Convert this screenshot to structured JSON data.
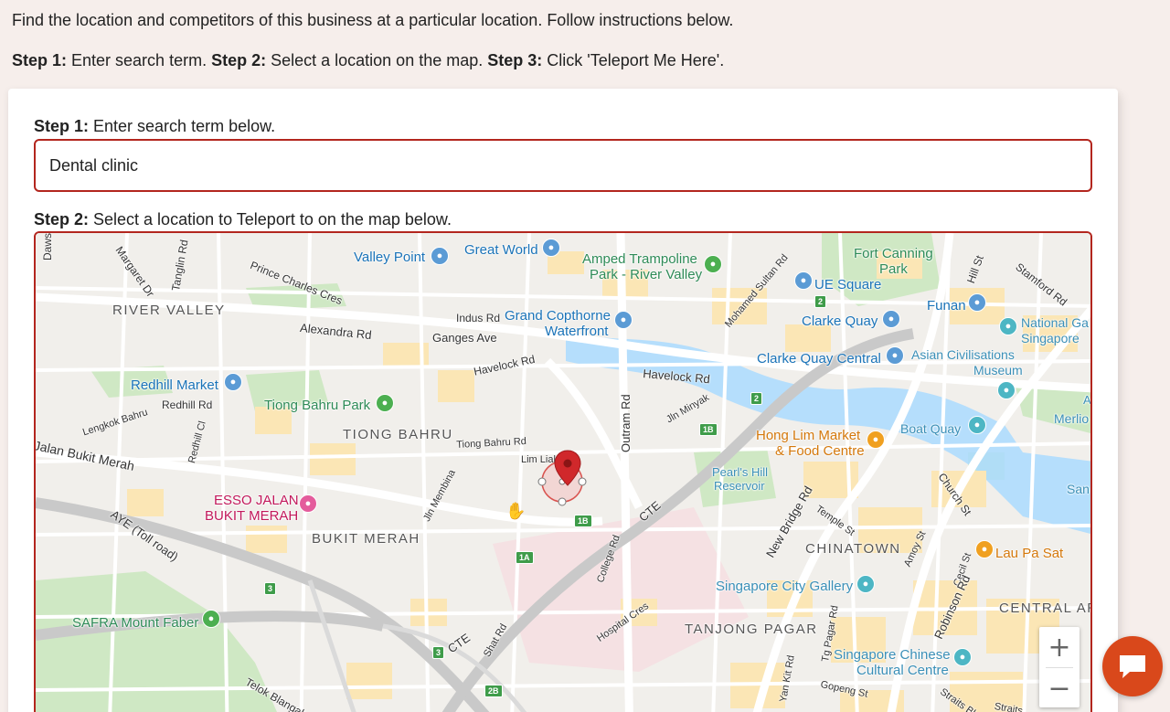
{
  "instructions": {
    "intro": "Find the location and competitors of this business at a particular location. Follow instructions below.",
    "step1_bold": "Step 1:",
    "step1_text": " Enter search term. ",
    "step2_bold": "Step 2:",
    "step2_text": " Select a location on the map. ",
    "step3_bold": "Step 3:",
    "step3_text": " Click 'Teleport Me Here'."
  },
  "form": {
    "step1_label_bold": "Step 1:",
    "step1_label_text": " Enter search term below.",
    "search_value": "Dental clinic",
    "step2_label_bold": "Step 2:",
    "step2_label_text": " Select a location to Teleport to on the map below."
  },
  "map": {
    "areas": {
      "river_valley": "RIVER VALLEY",
      "tiong_bahru": "TIONG BAHRU",
      "bukit_merah": "BUKIT MERAH",
      "chinatown": "CHINATOWN",
      "tanjong_pagar": "TANJONG PAGAR",
      "central_area": "CENTRAL AR"
    },
    "roads": {
      "dawson": "Dawso",
      "margaret_dr": "Margaret Dr",
      "tanglin_rd": "Tanglin Rd",
      "prince_charles": "Prince Charles Cres",
      "alexandra_rd": "Alexandra Rd",
      "indus_rd": "Indus Rd",
      "ganges_ave": "Ganges Ave",
      "havelock_rd_1": "Havelock Rd",
      "havelock_rd_2": "Havelock Rd",
      "redhill_rd": "Redhill Rd",
      "lengkok_bahru": "Lengkok Bahru",
      "redhill_cl": "Redhill Cl",
      "jalan_bukit_merah": "Jalan Bukit Merah",
      "tiong_bahru_rd": "Tiong Bahru Rd",
      "lim_liak": "Lim Liak",
      "jln_membina": "Jln Membina",
      "outram_rd": "Outram Rd",
      "jln_minyak": "Jln Minyak",
      "mohamed_sultan": "Mohamed Sultan Rd",
      "cte_1": "CTE",
      "cte_2": "CTE",
      "aye": "AYE (Toll road)",
      "college_rd": "College Rd",
      "hospital_cres": "Hospital Cres",
      "shat_rd": "Shat Rd",
      "telok_blangah": "Telok Blangah Way",
      "new_bridge": "New Bridge Rd",
      "temple_st": "Temple St",
      "amoy_st": "Amoy St",
      "cecil_st": "Cecil St",
      "robinson_rd": "Robinson Rd",
      "church_st": "Church St",
      "hill_st": "Hill St",
      "stamford_rd": "Stamford Rd",
      "tg_pagar_rd": "Tg Pagar Rd",
      "kan_kit_rd": "Yan Kit Rd",
      "gopeng_st": "Gopeng St",
      "straits_1": "Straits Bl",
      "straits_2": "Straits"
    },
    "pois": {
      "valley_point": "Valley Point",
      "great_world": "Great World",
      "amped_1": "Amped Trampoline",
      "amped_2": "Park - River Valley",
      "grand_copthorne_1": "Grand Copthorne",
      "grand_copthorne_2": "Waterfront",
      "fort_canning_1": "Fort Canning",
      "fort_canning_2": "Park",
      "ue_square": "UE Square",
      "clarke_quay": "Clarke Quay",
      "funan": "Funan",
      "national_gallery_1": "National Ga",
      "national_gallery_2": "Singapore",
      "clarke_quay_central": "Clarke Quay Central",
      "asian_civ_1": "Asian Civilisations",
      "asian_civ_2": "Museum",
      "redhill_market": "Redhill Market",
      "tiong_bahru_park": "Tiong Bahru Park",
      "hong_lim_1": "Hong Lim Market",
      "hong_lim_2": "& Food Centre",
      "boat_quay": "Boat Quay",
      "merlion": "Merlio",
      "pearls_hill_1": "Pearl's Hill",
      "pearls_hill_2": "Reservoir",
      "san": "San",
      "esso_1": "ESSO JALAN",
      "esso_2": "BUKIT MERAH",
      "lau_pa_sat": "Lau Pa Sat",
      "sg_city_gallery": "Singapore City Gallery",
      "safra": "SAFRA Mount Faber",
      "sg_chinese_1": "Singapore Chinese",
      "sg_chinese_2": "Cultural Centre",
      "a_label": "A"
    },
    "badges": {
      "b2a": "2",
      "b2b": "2",
      "b1b_a": "1B",
      "b1b_b": "1B",
      "b1a": "1A",
      "b3a": "3",
      "b3b": "3",
      "b2b_c": "2B"
    },
    "zoom_in": "+",
    "zoom_out": "−"
  },
  "colors": {
    "accent_border": "#b3261e",
    "chat_button": "#d9481b",
    "page_bg": "#f6eeeb"
  }
}
